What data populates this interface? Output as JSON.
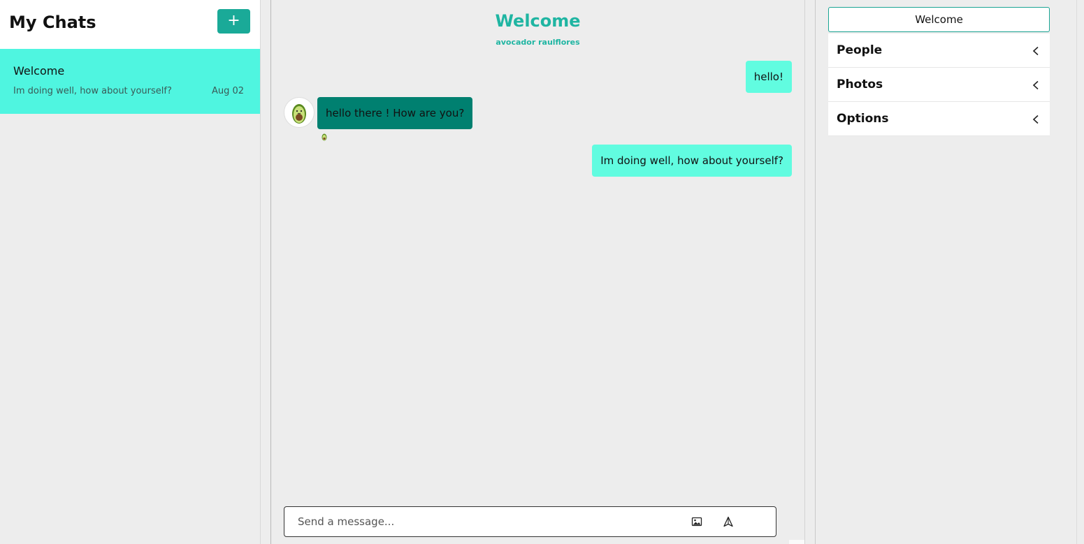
{
  "sidebar": {
    "title": "My Chats",
    "new_chat_label": "+",
    "chats": [
      {
        "title": "Welcome",
        "last_message": "Im doing well, how about yourself?",
        "date": "Aug 02"
      }
    ]
  },
  "chat": {
    "title": "Welcome",
    "subtitle": "avocador raulflores",
    "messages": [
      {
        "text": "hello!",
        "mine": true
      },
      {
        "text": "hello there ! How are you?",
        "mine": false,
        "avatar": "avocado-avatar"
      },
      {
        "text": "Im doing well, how about yourself?",
        "mine": true
      }
    ],
    "input_placeholder": "Send a message...",
    "icons": {
      "image": "image-icon",
      "send": "send-icon",
      "avatar": "avocado-icon"
    }
  },
  "settings": {
    "title": "Welcome",
    "sections": [
      "People",
      "Photos",
      "Options"
    ]
  },
  "colors": {
    "accent": "#1aaa98",
    "selected_chat": "#4ff5e0",
    "my_bubble": "#61fce0",
    "their_bubble": "#008070",
    "background": "#ededed"
  }
}
